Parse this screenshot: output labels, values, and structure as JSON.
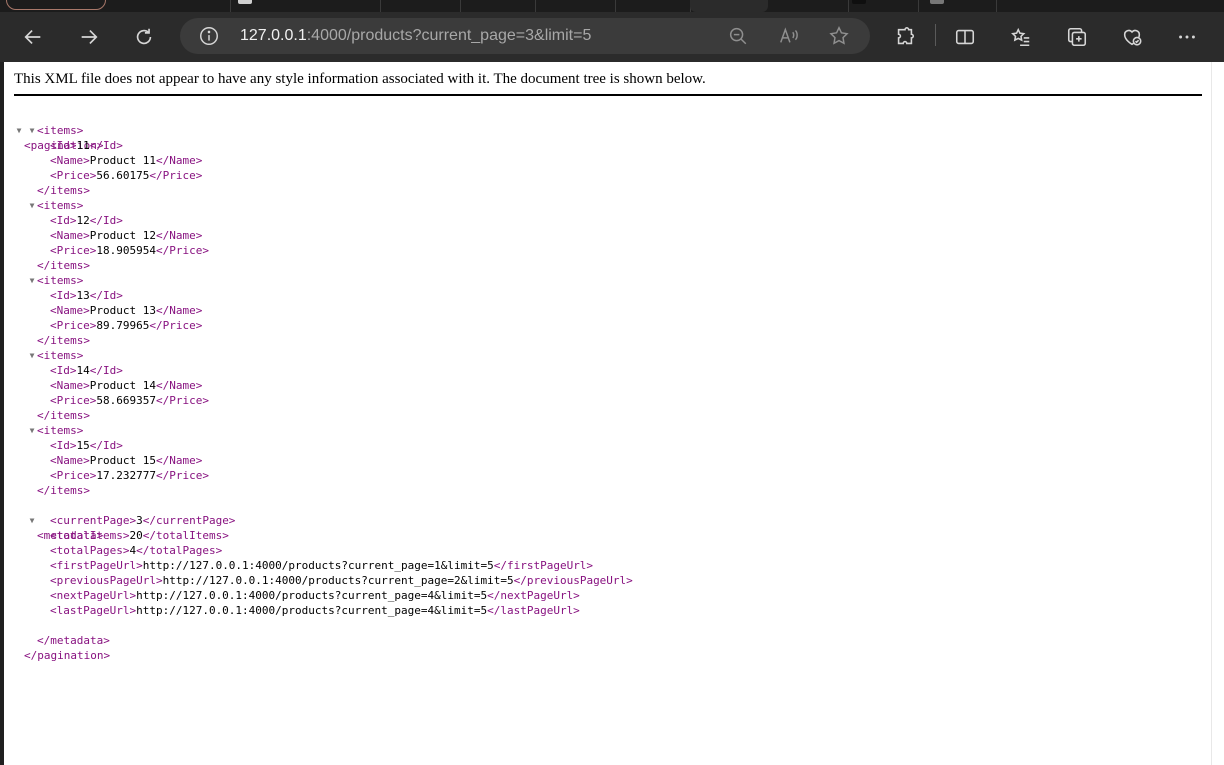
{
  "browser": {
    "url_host": "127.0.0.1",
    "url_rest": ":4000/products?current_page=3&limit=5"
  },
  "notice": "This XML file does not appear to have any style information associated with it. The document tree is shown below.",
  "tree": {
    "root_open": "<pagination>",
    "root_close": "</pagination>",
    "items_open": "<items>",
    "items_close": "</items>",
    "items": [
      {
        "id": "11",
        "name": "Product 11",
        "price": "56.60175"
      },
      {
        "id": "12",
        "name": "Product 12",
        "price": "18.905954"
      },
      {
        "id": "13",
        "name": "Product 13",
        "price": "89.79965"
      },
      {
        "id": "14",
        "name": "Product 14",
        "price": "58.669357"
      },
      {
        "id": "15",
        "name": "Product 15",
        "price": "17.232777"
      }
    ],
    "metadata_open": "<metadata>",
    "metadata_close": "</metadata>",
    "metadata": {
      "currentPage": "3",
      "totalItems": "20",
      "totalPages": "4",
      "firstPageUrl": "http://127.0.0.1:4000/products?current_page=1&limit=5",
      "previousPageUrl": "http://127.0.0.1:4000/products?current_page=2&limit=5",
      "nextPageUrl": "http://127.0.0.1:4000/products?current_page=4&limit=5",
      "lastPageUrl": "http://127.0.0.1:4000/products?current_page=4&limit=5"
    }
  },
  "icons": [
    "back-icon",
    "forward-icon",
    "refresh-icon",
    "info-icon",
    "zoom-out-icon",
    "read-aloud-icon",
    "favorite-star-icon",
    "extensions-icon",
    "split-screen-icon",
    "favorites-list-icon",
    "collections-icon",
    "browser-essentials-icon",
    "more-icon"
  ],
  "colors": {
    "tag": "#881280",
    "toolbar": "#2b2b2b",
    "addressbar": "#3b3b3b"
  }
}
